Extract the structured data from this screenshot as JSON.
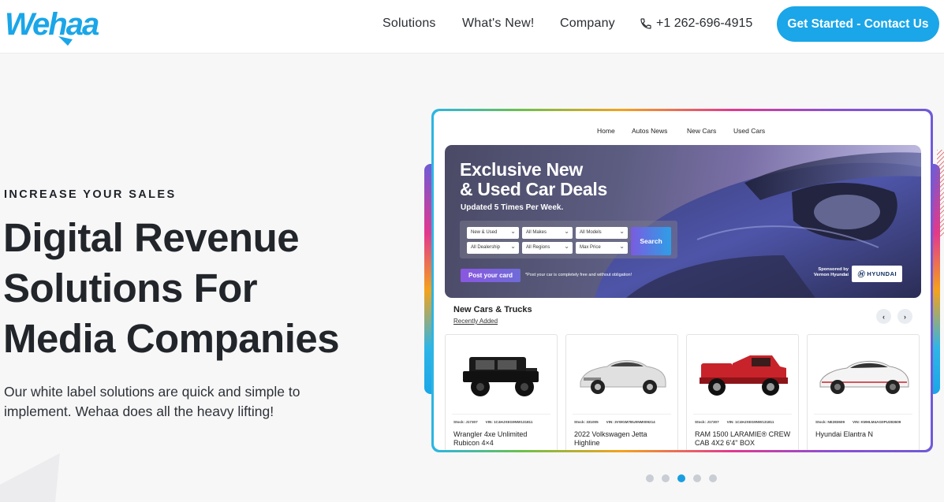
{
  "brand": {
    "logo_text": "Wehaa",
    "accent": "#1aa6e8"
  },
  "header": {
    "nav": [
      {
        "label": "Solutions"
      },
      {
        "label": "What's New!"
      },
      {
        "label": "Company"
      }
    ],
    "phone": {
      "icon": "phone-icon",
      "label": "+1 262-696-4915"
    },
    "cta_label": "Get Started - Contact Us"
  },
  "hero": {
    "eyebrow": "INCREASE YOUR SALES",
    "title_lines": [
      "Digital Revenue",
      "Solutions For",
      "Media Companies"
    ],
    "subtitle": "Our white label solutions are quick and simple to implement. Wehaa does all the heavy lifting!"
  },
  "mockup": {
    "nav": [
      "Home",
      "Autos News",
      "New Cars",
      "Used Cars"
    ],
    "banner": {
      "heading_lines": [
        "Exclusive New",
        "& Used Car Deals"
      ],
      "subheading": "Updated 5 Times Per Week.",
      "selects": [
        "New & Used",
        "All Makes",
        "All Models",
        "All Dealership",
        "All Regions",
        "Max Price"
      ],
      "search_label": "Search",
      "post_label": "Post your card",
      "post_note": "*Post your car is completely free and without obligation!",
      "sponsor_text": "Sponsored by Vernon Hyundai",
      "sponsor_logo": "HYUNDAI"
    },
    "section_title": "New Cars & Trucks",
    "section_subtitle": "Recently Added",
    "cards": [
      {
        "stock": "Stock: J17307",
        "vin": "VIN: 1C4HJXEG9NW131811",
        "name": "Wrangler 4xe Unlimited Rubicon 4×4",
        "color": "#1a1a1a"
      },
      {
        "stock": "Stock: 331005",
        "vin": "VIN: 3VWGM7BU0NM009214",
        "name": "2022 Volkswagen Jetta Highline",
        "color": "#dcdcdc"
      },
      {
        "stock": "Stock: J17307",
        "vin": "VIN: 1C4HJXEG9NW131811",
        "name": "RAM 1500 LARAMIE® CREW CAB 4X2 6'4\" BOX",
        "color": "#c8232a"
      },
      {
        "stock": "Stock: NE283609",
        "vin": "VIN: KMHLM4AG0PU283609",
        "name": "Hyundai Elantra N",
        "color": "#f2f2f2"
      }
    ]
  },
  "carousel": {
    "count": 5,
    "active_index": 2
  }
}
